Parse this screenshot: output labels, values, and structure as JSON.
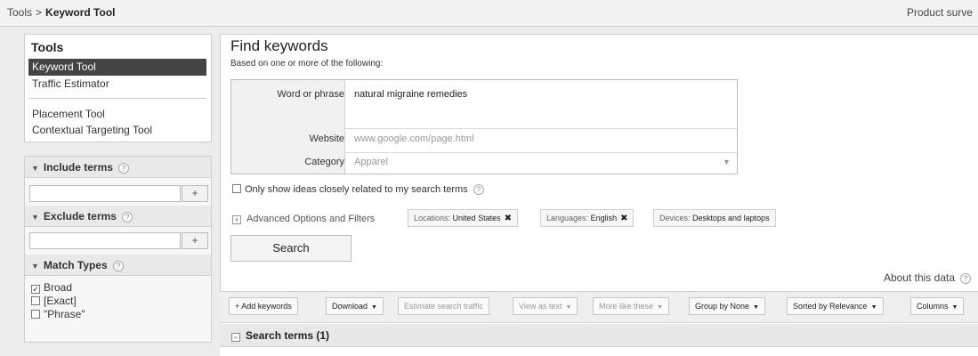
{
  "breadcrumb": {
    "root": "Tools",
    "separator": ">",
    "current": "Keyword Tool"
  },
  "topbar": {
    "right_link": "Product surve"
  },
  "tools": {
    "title": "Tools",
    "items": [
      {
        "label": "Keyword Tool",
        "active": true
      },
      {
        "label": "Traffic Estimator",
        "active": false
      },
      {
        "label": "Placement Tool",
        "active": false
      },
      {
        "label": "Contextual Targeting Tool",
        "active": false
      }
    ]
  },
  "filters": {
    "include": {
      "title": "Include terms",
      "value": "",
      "add": "+"
    },
    "exclude": {
      "title": "Exclude terms",
      "value": "",
      "add": "+"
    },
    "match": {
      "title": "Match Types",
      "options": [
        {
          "label": "Broad",
          "checked": true
        },
        {
          "label": "[Exact]",
          "checked": false
        },
        {
          "label": "\"Phrase\"",
          "checked": false
        }
      ]
    },
    "help": "?"
  },
  "find": {
    "title": "Find keywords",
    "subtitle": "Based on one or more of the following:",
    "fields": {
      "word_label": "Word or phrase",
      "word_value": "natural migraine remedies",
      "website_label": "Website",
      "website_placeholder": "www.google.com/page.html",
      "category_label": "Category",
      "category_placeholder": "Apparel"
    },
    "only_related": {
      "label": "Only show ideas closely related to my search terms",
      "checked": false
    },
    "advanced": {
      "label": "Advanced Options and Filters",
      "chips": [
        {
          "key": "Locations:",
          "value": "United States",
          "removable": true
        },
        {
          "key": "Languages:",
          "value": "English",
          "removable": true
        },
        {
          "key": "Devices:",
          "value": "Desktops and laptops",
          "removable": false
        }
      ]
    },
    "search_button": "Search",
    "about": "About this data"
  },
  "toolbar": {
    "buttons": [
      {
        "label": "Add keywords",
        "prefix": "+",
        "dropdown": false,
        "disabled": false
      },
      {
        "label": "Download",
        "prefix": "",
        "dropdown": true,
        "disabled": false
      },
      {
        "label": "Estimate search traffic",
        "prefix": "",
        "dropdown": false,
        "disabled": true
      },
      {
        "label": "View as text",
        "prefix": "",
        "dropdown": true,
        "disabled": true
      },
      {
        "label": "More like these",
        "prefix": "",
        "dropdown": true,
        "disabled": true
      },
      {
        "label": "Group by None",
        "prefix": "",
        "dropdown": true,
        "disabled": false
      },
      {
        "label": "Sorted by Relevance",
        "prefix": "",
        "dropdown": true,
        "disabled": false
      },
      {
        "label": "Columns",
        "prefix": "",
        "dropdown": true,
        "disabled": false
      }
    ]
  },
  "results": {
    "section_title": "Search terms (1)"
  },
  "colors": {
    "active_bg": "#444444",
    "panel_bg": "#ececec",
    "border": "#cfcfcf"
  },
  "icons": {
    "help": "question-circle-icon",
    "triangle": "triangle-down-icon",
    "remove": "x-icon",
    "expand": "plus-box-icon",
    "collapse": "minus-box-icon"
  }
}
